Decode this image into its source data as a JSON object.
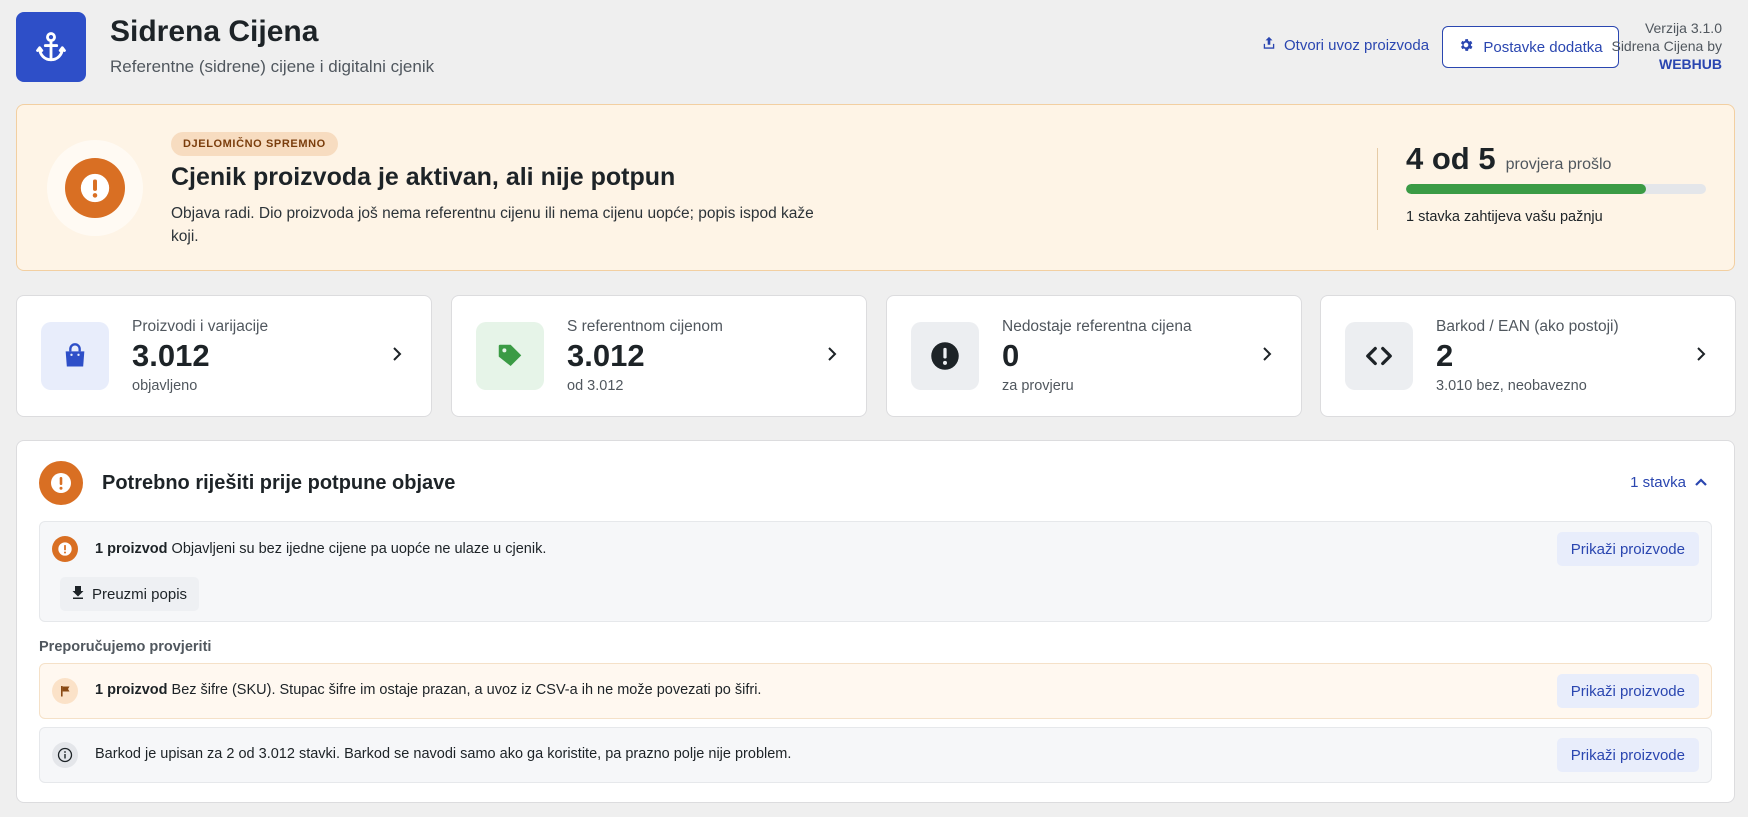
{
  "header": {
    "title": "Sidrena Cijena",
    "subtitle": "Referentne (sidrene) cijene i digitalni cjenik",
    "import_link": "Otvori uvoz proizvoda",
    "settings_button": "Postavke dodatka",
    "version": "Verzija 3.1.0",
    "byline": "Sidrena Cijena by",
    "brand": "WEBHUB"
  },
  "status": {
    "badge": "DJELOMIČNO SPREMNO",
    "title": "Cjenik proizvoda je aktivan, ali nije potpun",
    "description": "Objava radi. Dio proizvoda još nema referentnu cijenu ili nema cijenu uopće; popis ispod kaže koji.",
    "score": "4 od 5",
    "score_label": "provjera prošlo",
    "progress_percent": 80,
    "note": "1 stavka zahtijeva vašu pažnju",
    "colors": {
      "accent": "#d96f23",
      "progress": "#3b9b45"
    }
  },
  "cards": [
    {
      "label": "Proizvodi i varijacije",
      "value": "3.012",
      "sub": "objavljeno",
      "icon": "shopping-bag-icon",
      "color": "#2e4fc8"
    },
    {
      "label": "S referentnom cijenom",
      "value": "3.012",
      "sub": "od 3.012",
      "icon": "tag-icon",
      "color": "#3b9b45"
    },
    {
      "label": "Nedostaje referentna cijena",
      "value": "0",
      "sub": "za provjeru",
      "icon": "exclamation-circle-icon",
      "color": "#1d2327"
    },
    {
      "label": "Barkod / EAN (ako postoji)",
      "value": "2",
      "sub": "3.010 bez, neobavezno",
      "icon": "code-icon",
      "color": "#1d2327"
    }
  ],
  "issues": {
    "title": "Potrebno riješiti prije potpune objave",
    "count": "1 stavka",
    "required": {
      "count": "1 proizvod",
      "text": "Objavljeni su bez ijedne cijene pa uopće ne ulaze u cjenik.",
      "button": "Prikaži proizvode",
      "download": "Preuzmi popis"
    },
    "recommended_label": "Preporučujemo provjeriti",
    "recommended": [
      {
        "count": "1 proizvod",
        "text": "Bez šifre (SKU). Stupac šifre im ostaje prazan, a uvoz iz CSV-a ih ne može povezati po šifri.",
        "button": "Prikaži proizvode",
        "icon": "flag-icon"
      },
      {
        "count": "",
        "text": "Barkod je upisan za 2 od 3.012 stavki. Barkod se navodi samo ako ga koristite, pa prazno polje nije problem.",
        "button": "Prikaži proizvode",
        "icon": "info-icon"
      }
    ]
  }
}
